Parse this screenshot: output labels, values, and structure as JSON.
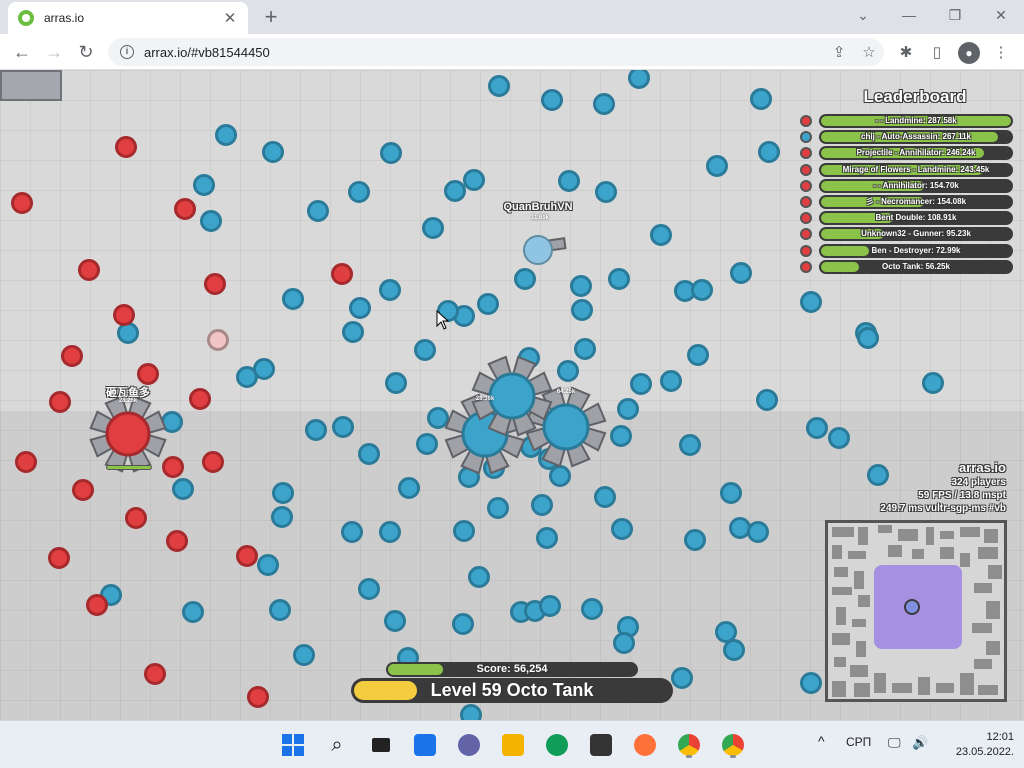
{
  "browser": {
    "tab_title": "arras.io",
    "url": "arrax.io/#vb81544450",
    "tab_close": "✕",
    "new_tab": "+",
    "minimize": "⌄",
    "restore": "—",
    "maximize": "❐",
    "close": "✕"
  },
  "leaderboard": {
    "title": "Leaderboard",
    "entries": [
      {
        "label": "-             - Landmine: 287.58k",
        "fill": 1.0,
        "color": "#e03e41"
      },
      {
        "label": "chij - Auto-Assassin: 267.11k",
        "fill": 0.93,
        "color": "#3ca4cb"
      },
      {
        "label": "Projectile - Annihilator: 246.24k",
        "fill": 0.86,
        "color": "#e03e41"
      },
      {
        "label": "Mirage of Flowers - Landmine: 243.45k",
        "fill": 0.85,
        "color": "#e03e41"
      },
      {
        "label": "-             - Annihilator: 154.70k",
        "fill": 0.54,
        "color": "#e03e41"
      },
      {
        "label": "彡 - Necromancer: 154.08k",
        "fill": 0.54,
        "color": "#e03e41"
      },
      {
        "label": "Bent Double: 108.91k",
        "fill": 0.38,
        "color": "#e03e41"
      },
      {
        "label": "Unknown32 - Gunner: 95.23k",
        "fill": 0.33,
        "color": "#e03e41"
      },
      {
        "label": "Ben - Destroyer: 72.99k",
        "fill": 0.25,
        "color": "#e03e41"
      },
      {
        "label": "Octo Tank: 56.25k",
        "fill": 0.2,
        "color": "#e03e41"
      }
    ]
  },
  "players": {
    "quanbruh": {
      "name": "QuanBruhVN",
      "score": "11.69k"
    },
    "red_player": {
      "name": "砸瓦鱼多",
      "score": "28.26k"
    },
    "blue_1": {
      "score": "28.36k"
    },
    "blue_2": {
      "score": "64.25k"
    }
  },
  "server_info": {
    "game": "arras.io",
    "players": "324 players",
    "fps": "59 FPS / 13.8 mspt",
    "ping": "249.7 ms  vultr-sgp-ms #vb"
  },
  "hud": {
    "score_label": "Score: 56,254",
    "score_progress": 0.22,
    "level_label": "Level 59 Octo Tank",
    "level_progress": 0.2
  },
  "taskbar": {
    "lang": "СРП",
    "up_arrow": "^",
    "time": "12:01",
    "date": "23.05.2022."
  },
  "colors": {
    "team_blue": "#3ca4cb",
    "team_red": "#e03e41",
    "tank_gray": "#9fa1a6"
  }
}
